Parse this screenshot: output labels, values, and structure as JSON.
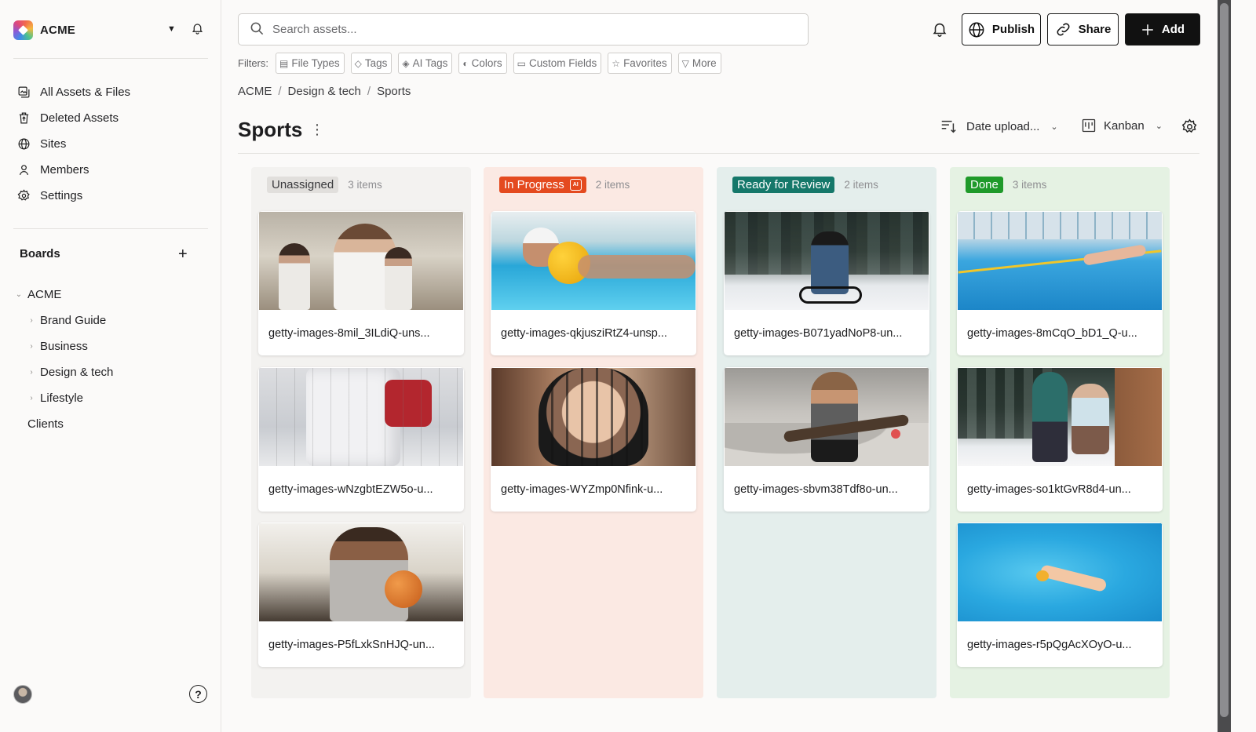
{
  "workspace": {
    "name": "ACME"
  },
  "nav": [
    {
      "label": "All Assets & Files",
      "icon": "assets-icon"
    },
    {
      "label": "Deleted Assets",
      "icon": "trash-icon"
    },
    {
      "label": "Sites",
      "icon": "globe-icon"
    },
    {
      "label": "Members",
      "icon": "user-icon"
    },
    {
      "label": "Settings",
      "icon": "gear-icon"
    }
  ],
  "boards": {
    "title": "Boards",
    "tree": [
      {
        "label": "ACME",
        "expanded": true
      },
      {
        "label": "Brand Guide"
      },
      {
        "label": "Business"
      },
      {
        "label": "Design & tech"
      },
      {
        "label": "Lifestyle"
      },
      {
        "label": "Clients"
      }
    ]
  },
  "search": {
    "placeholder": "Search assets..."
  },
  "actions": {
    "publish": "Publish",
    "share": "Share",
    "add": "Add"
  },
  "filters": {
    "label": "Filters:",
    "chips": [
      "File Types",
      "Tags",
      "AI Tags",
      "Colors",
      "Custom Fields",
      "Favorites",
      "More"
    ]
  },
  "breadcrumb": [
    "ACME",
    "Design & tech",
    "Sports"
  ],
  "page": {
    "title": "Sports",
    "sort": "Date upload...",
    "view": "Kanban"
  },
  "columns": [
    {
      "name": "Unassigned",
      "count": "3 items",
      "bg": "#f3f2f0",
      "badge_bg": "#e1dfdc",
      "badge_fg": "#3a3a3d",
      "cards": [
        "getty-images-8mil_3ILdiQ-uns...",
        "getty-images-wNzgbtEZW5o-u...",
        "getty-images-P5fLxkSnHJQ-un..."
      ]
    },
    {
      "name": "In Progress",
      "count": "2 items",
      "bg": "#fbe9e3",
      "badge_bg": "#e44a1f",
      "badge_fg": "#ffffff",
      "cards": [
        "getty-images-qkjuszіRtZ4-unsp...",
        "getty-images-WYZmp0Nfink-u..."
      ]
    },
    {
      "name": "Ready for Review",
      "count": "2 items",
      "bg": "#e4eeec",
      "badge_bg": "#15786a",
      "badge_fg": "#ffffff",
      "cards": [
        "getty-images-B071yadNoP8-un...",
        "getty-images-sbvm38Tdf8o-un..."
      ]
    },
    {
      "name": "Done",
      "count": "3 items",
      "bg": "#e5f2e3",
      "badge_bg": "#1f9a2a",
      "badge_fg": "#ffffff",
      "cards": [
        "getty-images-8mCqO_bD1_Q-u...",
        "getty-images-so1ktGvR8d4-un...",
        "getty-images-r5pQgAcXOyO-u..."
      ]
    }
  ]
}
